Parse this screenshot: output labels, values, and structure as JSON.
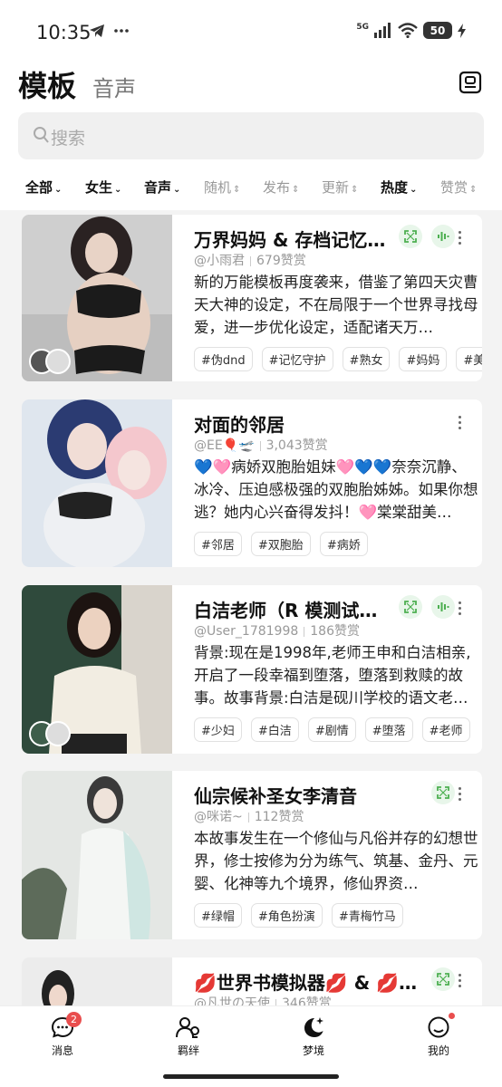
{
  "status_bar": {
    "time": "10:35",
    "network": "5G",
    "battery": "50"
  },
  "header": {
    "title": "模板",
    "tab": "音声"
  },
  "search": {
    "placeholder": "搜索"
  },
  "filters": [
    {
      "label": "全部",
      "active": true
    },
    {
      "label": "女生",
      "active": true
    },
    {
      "label": "音声",
      "active": true
    },
    {
      "label": "随机",
      "active": false
    },
    {
      "label": "发布",
      "active": false
    },
    {
      "label": "更新",
      "active": false
    },
    {
      "label": "热度",
      "active": true
    },
    {
      "label": "赞赏",
      "active": false
    }
  ],
  "cards": [
    {
      "title": "万界妈妈 & 存档记忆机…",
      "author": "@小雨君",
      "likes": "679赞赏",
      "description": "新的万能模板再度袭来，借鉴了第四天灾曹天大神的设定，不在局限于一个世界寻找母爱，进一步优化设定，适配诸天万…",
      "tags": [
        "#伪dnd",
        "#记忆守护",
        "#熟女",
        "#妈妈",
        "#美母"
      ]
    },
    {
      "title": "对面的邻居",
      "author": "@EE🎈🛫",
      "likes": "3,043赞赏",
      "description": "💙🩷病娇双胞胎姐妹🩷💙💙奈奈沉静、冰冷、压迫感极强的双胞胎姊姊。如果你想逃？她内心兴奋得发抖！🩷棠棠甜美…",
      "tags": [
        "#邻居",
        "#双胞胎",
        "#病娇"
      ]
    },
    {
      "title": "白洁老师（R 模测试版…",
      "author": "@User_1781998",
      "likes": "186赞赏",
      "description": "背景:现在是1998年,老师王申和白洁相亲,开启了一段幸福到堕落，堕落到救赎的故事。故事背景:白洁是砚川学校的语文老…",
      "tags": [
        "#少妇",
        "#白洁",
        "#剧情",
        "#堕落",
        "#老师"
      ]
    },
    {
      "title": "仙宗候补圣女李清音",
      "author": "@咪诺~",
      "likes": "112赞赏",
      "description": "本故事发生在一个修仙与凡俗并存的幻想世界，修士按修为分为练气、筑基、金丹、元婴、化神等九个境界，修仙界资…",
      "tags": [
        "#绿帽",
        "#角色扮演",
        "#青梅竹马"
      ]
    },
    {
      "title": "💋世界书模拟器💋 & 💋世…",
      "author": "@凡世の天使",
      "likes": "346赞赏"
    }
  ],
  "bottom_nav": [
    {
      "label": "消息",
      "badge": "2"
    },
    {
      "label": "羁绊"
    },
    {
      "label": "梦境"
    },
    {
      "label": "我的"
    }
  ],
  "colors": {
    "accent_green": "#4caf50",
    "badge_red": "#e94e4e"
  }
}
